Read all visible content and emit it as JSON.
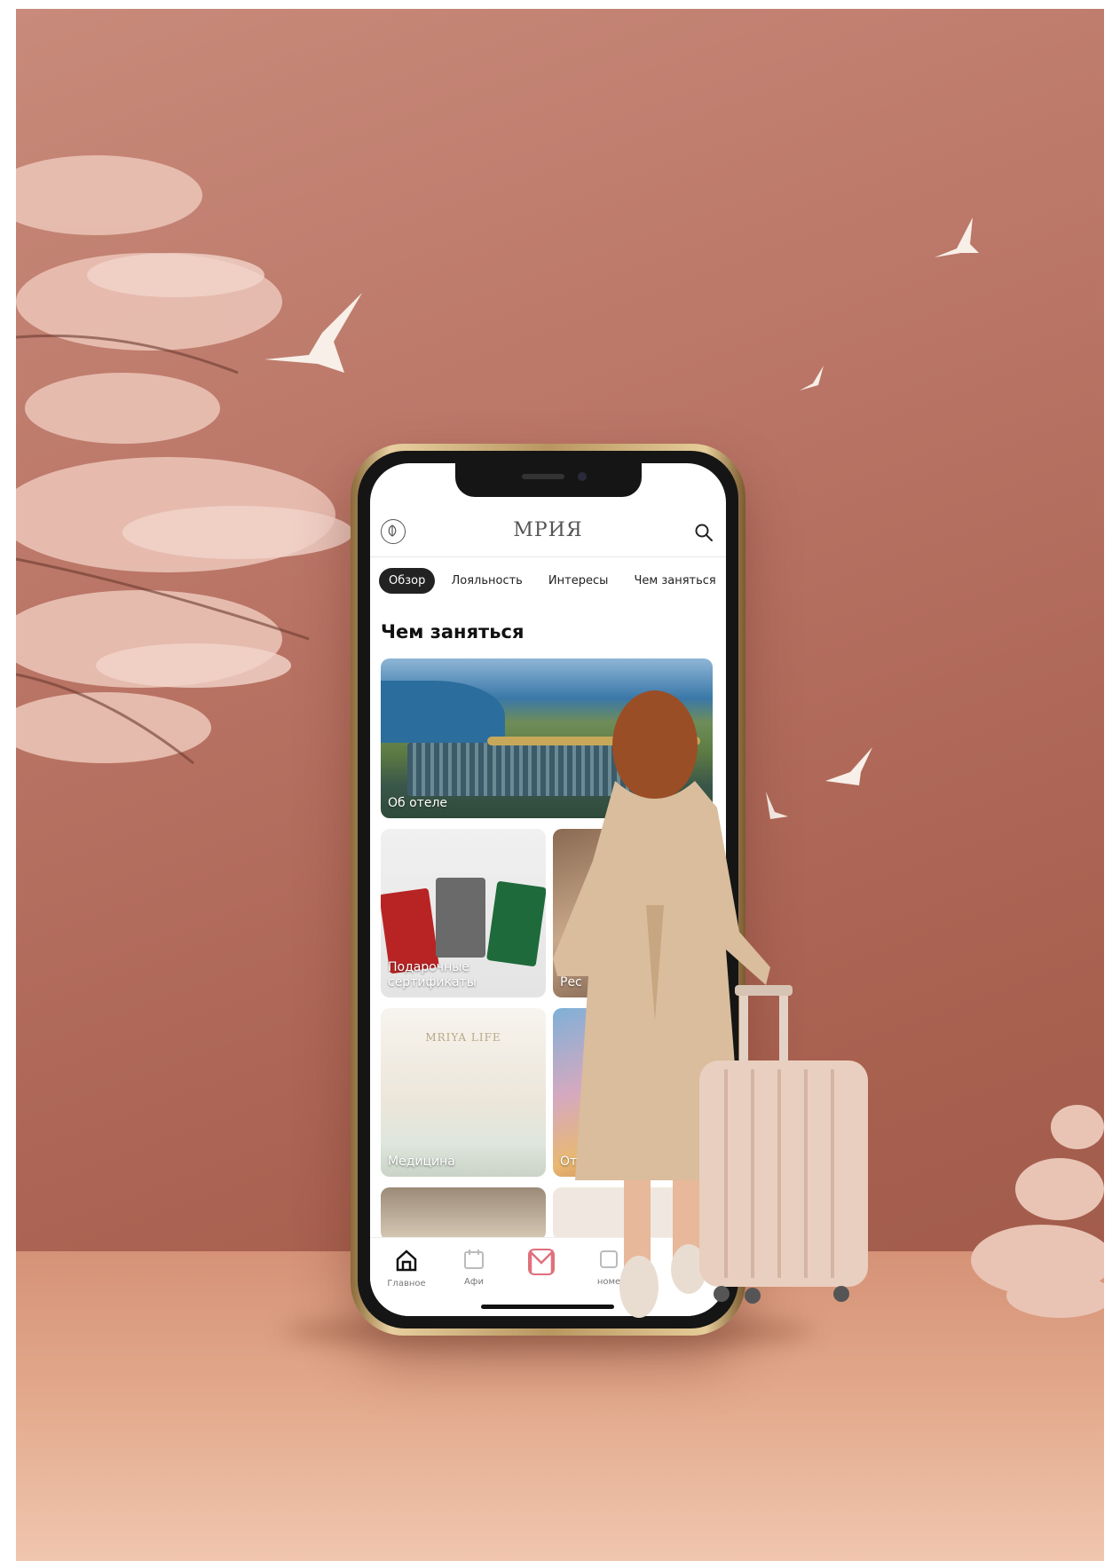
{
  "app": {
    "title": "МРИЯ",
    "icons": {
      "logo": "leaf-emblem-icon",
      "search": "search-icon"
    }
  },
  "tabs": [
    {
      "label": "Обзор",
      "active": true
    },
    {
      "label": "Лояльность",
      "active": false
    },
    {
      "label": "Интересы",
      "active": false
    },
    {
      "label": "Чем заняться",
      "active": false
    }
  ],
  "section": {
    "title": "Чем заняться"
  },
  "cards": {
    "hotel": {
      "label": "Об отеле"
    },
    "gift": {
      "label_line1": "Подарочные",
      "label_line2": "сертификаты"
    },
    "rest": {
      "label": "Рес"
    },
    "med": {
      "label": "Медицина",
      "brand": "MRIYA LIFE"
    },
    "rest2": {
      "label": "Отд"
    }
  },
  "bottom_nav": [
    {
      "label": "Главное",
      "icon": "home-icon"
    },
    {
      "label": "Афи",
      "icon": "calendar-icon"
    },
    {
      "label": "",
      "icon": "brand-m-icon"
    },
    {
      "label": "номе",
      "icon": "room-icon"
    }
  ],
  "colors": {
    "background": "#b97465",
    "accent": "#e0707a",
    "active_tab": "#222222"
  }
}
